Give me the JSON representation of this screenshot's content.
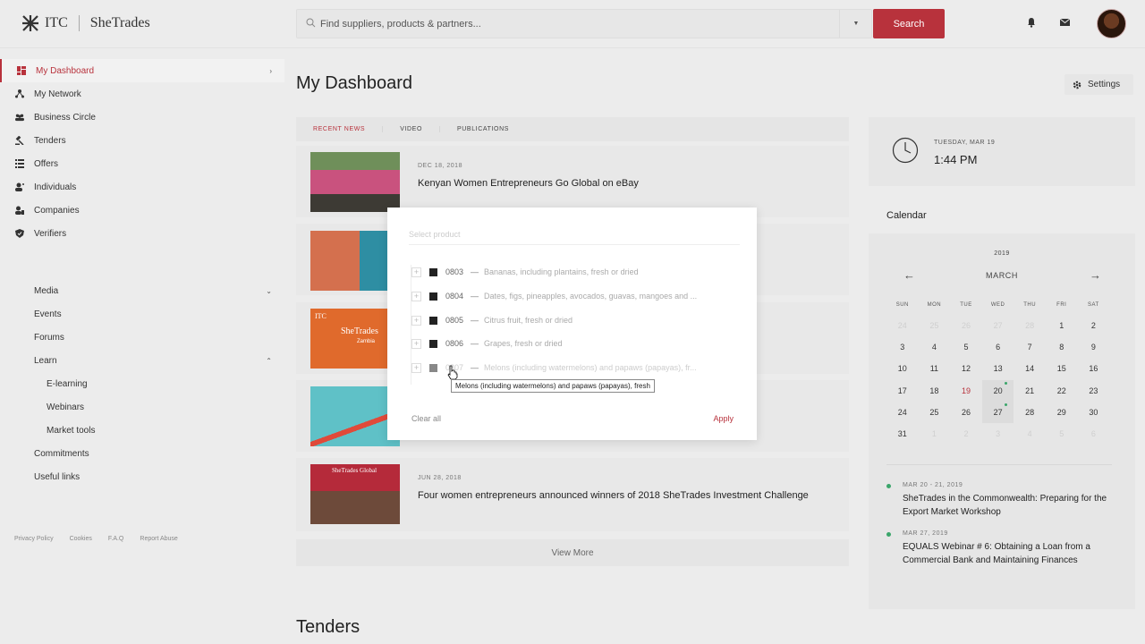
{
  "header": {
    "logo_itc": "ITC",
    "logo_name": "SheTrades",
    "search_placeholder": "Find suppliers, products & partners...",
    "search_button": "Search",
    "icons": [
      "search-icon",
      "chevron-down-icon",
      "bell-icon",
      "mail-icon",
      "avatar"
    ]
  },
  "sidebar": {
    "items": [
      {
        "label": "My Dashboard",
        "icon": "dashboard-icon"
      },
      {
        "label": "My Network",
        "icon": "network-icon"
      },
      {
        "label": "Business Circle",
        "icon": "users-icon"
      },
      {
        "label": "Tenders",
        "icon": "gavel-icon"
      },
      {
        "label": "Offers",
        "icon": "list-icon"
      },
      {
        "label": "Individuals",
        "icon": "person-icon"
      },
      {
        "label": "Companies",
        "icon": "company-icon"
      },
      {
        "label": "Verifiers",
        "icon": "shield-icon"
      }
    ],
    "secondary": [
      {
        "label": "Media"
      },
      {
        "label": "Events"
      },
      {
        "label": "Forums"
      },
      {
        "label": "Learn"
      }
    ],
    "learn_sub": [
      {
        "label": "E-learning"
      },
      {
        "label": "Webinars"
      },
      {
        "label": "Market tools"
      }
    ],
    "tertiary": [
      {
        "label": "Commitments"
      },
      {
        "label": "Useful links"
      }
    ],
    "footer": [
      "Privacy Policy",
      "Cookies",
      "F.A.Q",
      "Report Abuse"
    ]
  },
  "main": {
    "title": "My Dashboard",
    "settings_label": "Settings",
    "tabs": [
      "RECENT NEWS",
      "VIDEO",
      "PUBLICATIONS"
    ],
    "news": [
      {
        "date": "DEC 18, 2018",
        "title": "Kenyan Women Entrepreneurs Go Global on eBay"
      },
      {
        "date": "",
        "title": ""
      },
      {
        "date": "",
        "title": ""
      },
      {
        "date": "",
        "title": ""
      },
      {
        "date": "JUN 28, 2018",
        "title": "Four women entrepreneurs announced winners of 2018 SheTrades Investment Challenge"
      }
    ],
    "thumb_texts": {
      "itc": "ITC",
      "shetrades": "SheTrades",
      "zambia": "Zambia",
      "global": "SheTrades Global"
    },
    "view_more": "View More",
    "tenders_title": "Tenders"
  },
  "clock": {
    "date": "TUESDAY, MAR 19",
    "time": "1:44 PM"
  },
  "calendar": {
    "heading": "Calendar",
    "year": "2019",
    "month": "MARCH",
    "prev": "←",
    "next": "→",
    "dow": [
      "SUN",
      "MON",
      "TUE",
      "WED",
      "THU",
      "FRI",
      "SAT"
    ],
    "days": [
      {
        "n": "24",
        "muted": true
      },
      {
        "n": "25",
        "muted": true
      },
      {
        "n": "26",
        "muted": true
      },
      {
        "n": "27",
        "muted": true
      },
      {
        "n": "28",
        "muted": true
      },
      {
        "n": "1"
      },
      {
        "n": "2"
      },
      {
        "n": "3"
      },
      {
        "n": "4"
      },
      {
        "n": "5"
      },
      {
        "n": "6"
      },
      {
        "n": "7"
      },
      {
        "n": "8"
      },
      {
        "n": "9"
      },
      {
        "n": "10"
      },
      {
        "n": "11"
      },
      {
        "n": "12"
      },
      {
        "n": "13"
      },
      {
        "n": "14"
      },
      {
        "n": "15"
      },
      {
        "n": "16"
      },
      {
        "n": "17"
      },
      {
        "n": "18"
      },
      {
        "n": "19",
        "today": true
      },
      {
        "n": "20",
        "hl": true,
        "dot": true
      },
      {
        "n": "21"
      },
      {
        "n": "22"
      },
      {
        "n": "23"
      },
      {
        "n": "24"
      },
      {
        "n": "25"
      },
      {
        "n": "26"
      },
      {
        "n": "27",
        "hl": true,
        "dot": true
      },
      {
        "n": "28"
      },
      {
        "n": "29"
      },
      {
        "n": "30"
      },
      {
        "n": "31"
      },
      {
        "n": "1",
        "muted": true
      },
      {
        "n": "2",
        "muted": true
      },
      {
        "n": "3",
        "muted": true
      },
      {
        "n": "4",
        "muted": true
      },
      {
        "n": "5",
        "muted": true
      },
      {
        "n": "6",
        "muted": true
      }
    ],
    "events": [
      {
        "date": "MAR 20 - 21, 2019",
        "title": "SheTrades in the Commonwealth: Preparing for the Export Market Workshop"
      },
      {
        "date": "MAR 27, 2019",
        "title": "EQUALS Webinar # 6: Obtaining a Loan from a Commercial Bank and Maintaining Finances"
      }
    ]
  },
  "modal": {
    "placeholder": "Select product",
    "products": [
      {
        "code": "0803",
        "desc": "Bananas, including plantains, fresh or dried"
      },
      {
        "code": "0804",
        "desc": "Dates, figs, pineapples, avocados, guavas, mangoes and ..."
      },
      {
        "code": "0805",
        "desc": "Citrus fruit, fresh or dried"
      },
      {
        "code": "0806",
        "desc": "Grapes, fresh or dried"
      },
      {
        "code": "0807",
        "desc": "Melons (including watermelons) and papaws (papayas), fr..."
      }
    ],
    "plus": "+",
    "dash": "—",
    "tooltip": "Melons (including watermelons) and papaws (papayas), fresh",
    "clear_all": "Clear all",
    "apply": "Apply"
  },
  "colors": {
    "accent": "#b8323c",
    "event_dot": "#3aa56a",
    "background": "#ececec"
  }
}
